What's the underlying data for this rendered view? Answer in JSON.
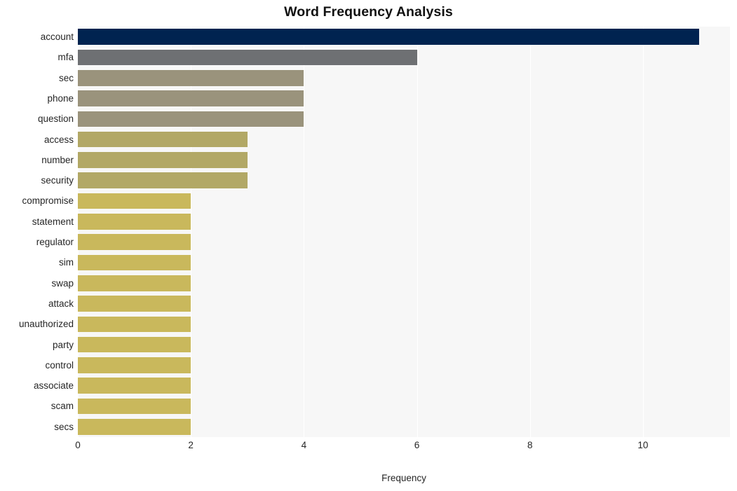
{
  "chart_data": {
    "type": "bar",
    "orientation": "horizontal",
    "title": "Word Frequency Analysis",
    "xlabel": "Frequency",
    "ylabel": "",
    "categories": [
      "account",
      "mfa",
      "sec",
      "phone",
      "question",
      "access",
      "number",
      "security",
      "compromise",
      "statement",
      "regulator",
      "sim",
      "swap",
      "attack",
      "unauthorized",
      "party",
      "control",
      "associate",
      "scam",
      "secs"
    ],
    "values": [
      11,
      6,
      4,
      4,
      4,
      3,
      3,
      3,
      2,
      2,
      2,
      2,
      2,
      2,
      2,
      2,
      2,
      2,
      2,
      2
    ],
    "bar_colors": [
      "#002350",
      "#6e7073",
      "#9a937c",
      "#9a937c",
      "#9a937c",
      "#b2a866",
      "#b2a866",
      "#b2a866",
      "#c9b85c",
      "#c9b85c",
      "#c9b85c",
      "#c9b85c",
      "#c9b85c",
      "#c9b85c",
      "#c9b85c",
      "#c9b85c",
      "#c9b85c",
      "#c9b85c",
      "#c9b85c",
      "#c9b85c"
    ],
    "xlim": [
      0,
      11.54
    ],
    "xticks": [
      0,
      2,
      4,
      6,
      8,
      10
    ],
    "xtick_labels": [
      "0",
      "2",
      "4",
      "6",
      "8",
      "10"
    ],
    "grid": {
      "vertical": true,
      "horizontal": false,
      "color": "#ffffff"
    },
    "plot_background": "#f7f7f7",
    "figure_background": "#ffffff",
    "legend": null
  }
}
